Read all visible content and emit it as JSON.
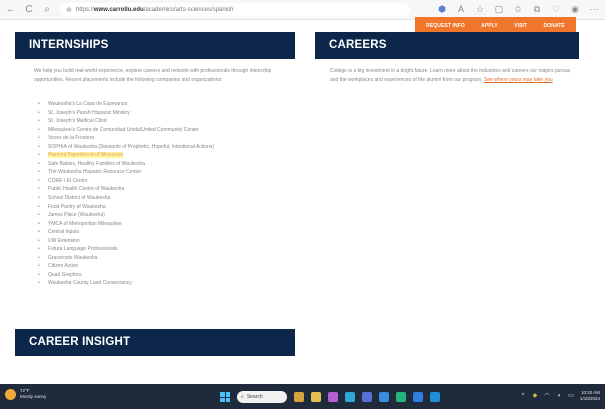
{
  "browser": {
    "url_prefix": "https://",
    "url_domain": "www.carrollu.edu",
    "url_path": "/academics/arts-sciences/spanish"
  },
  "site_nav": [
    "REQUEST INFO",
    "APPLY",
    "VISIT",
    "DONATE"
  ],
  "internships": {
    "heading": "INTERNSHIPS",
    "intro": "We help you build real-world experience, explore careers and network with professionals through internship opportunities. Recent placements include the following companies and organizations:",
    "items": [
      "Waukesha's La Casa de Esperanza",
      "St. Joseph's Parish Hispanic Ministry",
      "St. Joseph's Medical Clinic",
      "Milwaukee's Centro de Comunidad Unida/United Community Center",
      "Voces de la Frontera",
      "SOPHIA of Waukesha (Stewards of Prophetic, Hopeful, Intentional Actions)",
      "Planned Parenthood of Wisconsin",
      "Safe Babies, Healthy Families of Waukesha",
      "The Waukesha Hispanic Resource Center",
      "CORE / El Centro",
      "Public Health Centre of Waukesha",
      "School District of Waukesha",
      "Food Pantry of Waukesha",
      "James Place (Waukesha)",
      "YMCA of Metropolitan Milwaukee",
      "Central Inputs",
      "UW Extension",
      "Futura Language Professionals",
      "Grassroots Waukesha",
      "Citizen Action",
      "Quad Graphics",
      "Waukesha County Land Conservancy"
    ]
  },
  "careers": {
    "heading": "CAREERS",
    "text": "College is a big investment in a bright future. Learn more about the industries and careers our majors pursue, and the workplaces and experiences of the alumni from our program.",
    "link": "See where yours may take you"
  },
  "career_insight": {
    "heading": "CAREER INSIGHT"
  },
  "taskbar": {
    "temperature": "72°F",
    "weather": "Mostly sunny",
    "search": "Search",
    "time": "10:20 AM",
    "date": "1/16/2024"
  },
  "colors": {
    "navy": "#0c2749",
    "orange": "#f0762b",
    "highlight": "#fff59b"
  }
}
